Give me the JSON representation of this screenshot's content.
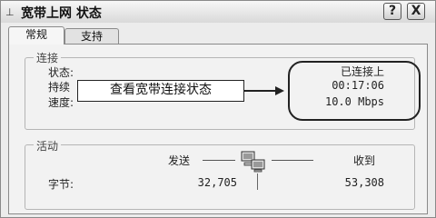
{
  "window": {
    "title": "宽带上网 状态",
    "help_label": "?",
    "close_label": "X"
  },
  "tabs": [
    {
      "label": "常规"
    },
    {
      "label": "支持"
    }
  ],
  "connection": {
    "group_label": "连接",
    "status_label": "状态:",
    "duration_label": "持续",
    "speed_label": "速度:",
    "status_value": "已连接上",
    "duration_value": "00:17:06",
    "speed_value": "10.0 Mbps"
  },
  "annotation": {
    "text": "查看宽带连接状态"
  },
  "activity": {
    "group_label": "活动",
    "sent_label": "发送",
    "received_label": "收到",
    "bytes_label": "字节:",
    "bytes_sent": "32,705",
    "bytes_received": "53,308"
  },
  "icons": {
    "app": "network-icon",
    "activity": "network-computers-icon"
  }
}
